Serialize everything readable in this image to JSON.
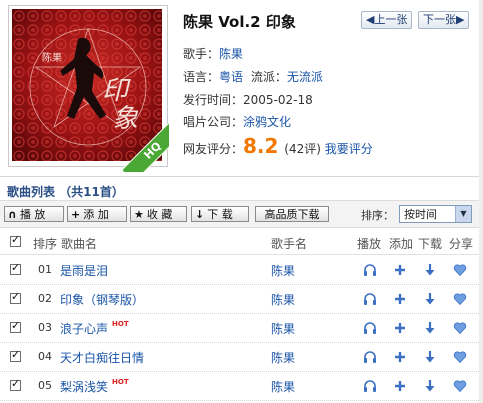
{
  "album": {
    "title": "陈果  Vol.2 印象",
    "cover_badge": "HQ",
    "prev_label": "◀上一张",
    "next_label": "下一张▶",
    "singer_label": "歌手：",
    "singer": "陈果",
    "language_label": "语言：",
    "language": "粤语",
    "genre_label": "流派：",
    "genre": "无流派",
    "release_label": "发行时间：",
    "release_date": "2005-02-18",
    "label_label": "唱片公司：",
    "record_label": "涂鸦文化",
    "rating_label": "网友评分：",
    "rating": "8.2",
    "rating_count": "(42评)",
    "rate_link": "我要评分"
  },
  "list": {
    "title": "歌曲列表 （共11首）",
    "toolbar": {
      "play": "播 放",
      "add": "添 加",
      "collect": "收 藏",
      "download": "下 载",
      "hq_download": "高品质下载",
      "sort_label": "排序：",
      "sort_value": "按时间"
    },
    "headers": {
      "index": "排序",
      "song": "歌曲名",
      "artist": "歌手名",
      "play": "播放",
      "add": "添加",
      "download": "下载",
      "share": "分享"
    },
    "songs": [
      {
        "num": "01",
        "name": "是雨是泪",
        "hot": "",
        "artist": "陈果"
      },
      {
        "num": "02",
        "name": "印象（钢琴版）",
        "hot": "",
        "artist": "陈果"
      },
      {
        "num": "03",
        "name": "浪子心声",
        "hot": "HOT",
        "artist": "陈果"
      },
      {
        "num": "04",
        "name": "天才白痴往日情",
        "hot": "",
        "artist": "陈果"
      },
      {
        "num": "05",
        "name": "梨涡浅笑",
        "hot": "HOT",
        "artist": "陈果"
      }
    ]
  },
  "colors": {
    "link": "#1a55a8",
    "rating": "#f07800",
    "icon_blue": "#3b6fc4",
    "hot": "#e02020"
  }
}
